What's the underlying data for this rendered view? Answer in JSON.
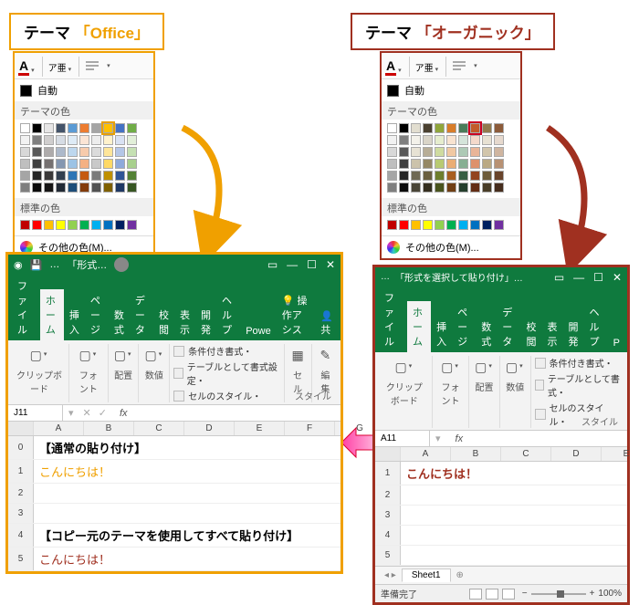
{
  "badges": {
    "office": {
      "prefix": "テーマ",
      "name": "「Office」",
      "color": "#f0a000"
    },
    "organic": {
      "prefix": "テーマ",
      "name": "「オーガニック」",
      "color": "#a03020"
    }
  },
  "picker": {
    "auto_label": "自動",
    "theme_colors_label": "テーマの色",
    "standard_colors_label": "標準の色",
    "more_colors_label": "その他の色(M)...",
    "office_theme_row": [
      "#ffffff",
      "#000000",
      "#e7e6e6",
      "#44546a",
      "#5b9bd5",
      "#ed7d31",
      "#a5a5a5",
      "#ffc000",
      "#4472c4",
      "#70ad47"
    ],
    "organic_theme_row": [
      "#ffffff",
      "#000000",
      "#e2ded0",
      "#4a4030",
      "#90a63c",
      "#d87d2a",
      "#4a7c59",
      "#c35b2a",
      "#927b4e",
      "#8c5b3a"
    ],
    "tint_rows_office": [
      [
        "#f2f2f2",
        "#7f7f7f",
        "#d0cece",
        "#d6dce4",
        "#deebf6",
        "#fbe5d5",
        "#ededed",
        "#fff2cc",
        "#d9e2f3",
        "#e2efd9"
      ],
      [
        "#d8d8d8",
        "#595959",
        "#aeabab",
        "#adb9ca",
        "#bdd7ee",
        "#f7cbac",
        "#dbdbdb",
        "#fee599",
        "#b4c6e7",
        "#c5e0b3"
      ],
      [
        "#bfbfbf",
        "#3f3f3f",
        "#757070",
        "#8496b0",
        "#9cc3e5",
        "#f4b183",
        "#c9c9c9",
        "#ffd965",
        "#8eaadb",
        "#a8d08d"
      ],
      [
        "#a5a5a5",
        "#262626",
        "#3a3838",
        "#323f4f",
        "#2e75b5",
        "#c55a11",
        "#7b7b7b",
        "#bf9000",
        "#2f5496",
        "#538135"
      ],
      [
        "#7f7f7f",
        "#0c0c0c",
        "#171616",
        "#222a35",
        "#1e4e79",
        "#833c0b",
        "#525252",
        "#7f6000",
        "#1f3864",
        "#375623"
      ]
    ],
    "tint_rows_organic": [
      [
        "#f2f2f2",
        "#7f7f7f",
        "#f3f1ea",
        "#d9d4c8",
        "#e6edce",
        "#f8e3d0",
        "#d5e4da",
        "#f4d9cb",
        "#e7e1d3",
        "#e6d9ce"
      ],
      [
        "#d8d8d8",
        "#595959",
        "#e7e2d4",
        "#b7ad97",
        "#cfdba0",
        "#f1c8a2",
        "#adc9b5",
        "#e9b598",
        "#d1c5ab",
        "#cfb5a0"
      ],
      [
        "#bfbfbf",
        "#3f3f3f",
        "#ccc3ab",
        "#958865",
        "#b8ca72",
        "#eaad74",
        "#86af92",
        "#de916c",
        "#baa983",
        "#b89173"
      ],
      [
        "#a5a5a5",
        "#262626",
        "#6f6954",
        "#6a5f3f",
        "#6e7e2d",
        "#a85e20",
        "#375e43",
        "#93441f",
        "#6e5c3a",
        "#69442b"
      ],
      [
        "#7f7f7f",
        "#0c0c0c",
        "#4a4638",
        "#352f1f",
        "#49541e",
        "#703f15",
        "#253f2d",
        "#622d15",
        "#493d27",
        "#462d1d"
      ]
    ],
    "standard_row": [
      "#c00000",
      "#ff0000",
      "#ffc000",
      "#ffff00",
      "#92d050",
      "#00b050",
      "#00b0f0",
      "#0070c0",
      "#002060",
      "#7030a0"
    ]
  },
  "excel_left": {
    "title": "「形式…",
    "tabs": [
      "ファイル",
      "ホーム",
      "挿入",
      "ページ",
      "数式",
      "データ",
      "校閲",
      "表示",
      "開発",
      "ヘルプ",
      "Powe"
    ],
    "active_tab_index": 1,
    "assist": "操作アシス",
    "share": "共",
    "ribbon_groups": [
      "クリップボード",
      "フォント",
      "配置",
      "数値"
    ],
    "ribbon_right": {
      "cond": "条件付き書式・",
      "tbl": "テーブルとして書式設定・",
      "cell": "セルのスタイル・",
      "group2": "セル",
      "group3": "編集"
    },
    "ribbon_label": "スタイル",
    "name_box": "J11",
    "columns": [
      "A",
      "B",
      "C",
      "D",
      "E",
      "F",
      "G"
    ],
    "rows": [
      {
        "n": "",
        "text": "【通常の貼り付け】",
        "bold": true,
        "color": "#000"
      },
      {
        "n": "1",
        "text": "こんにちは！",
        "bold": false,
        "color": "#f0a000"
      },
      {
        "n": "2",
        "text": "",
        "bold": false,
        "color": "#000"
      },
      {
        "n": "3",
        "text": "",
        "bold": false,
        "color": "#000"
      },
      {
        "n": "4",
        "text": "【コピー元のテーマを使用してすべて貼り付け】",
        "bold": true,
        "color": "#000"
      },
      {
        "n": "5",
        "text": "こんにちは！",
        "bold": false,
        "color": "#a03020"
      }
    ]
  },
  "excel_right": {
    "title": "「形式を選択して貼り付け」…",
    "tabs": [
      "ファイル",
      "ホーム",
      "挿入",
      "ページ",
      "数式",
      "データ",
      "校閲",
      "表示",
      "開発",
      "ヘルプ",
      "P"
    ],
    "active_tab_index": 1,
    "ribbon_groups": [
      "クリップボード",
      "フォント",
      "配置",
      "数値"
    ],
    "ribbon_right": {
      "cond": "条件付き書式・",
      "tbl": "テーブルとして書式・",
      "cell": "セルのスタイル・"
    },
    "ribbon_label": "スタイル",
    "name_box": "A11",
    "columns": [
      "A",
      "B",
      "C",
      "D",
      "E"
    ],
    "hello": "こんにちは！",
    "hello_color": "#a03020",
    "sheet_tab": "Sheet1",
    "status": "準備完了",
    "zoom": "100%"
  }
}
